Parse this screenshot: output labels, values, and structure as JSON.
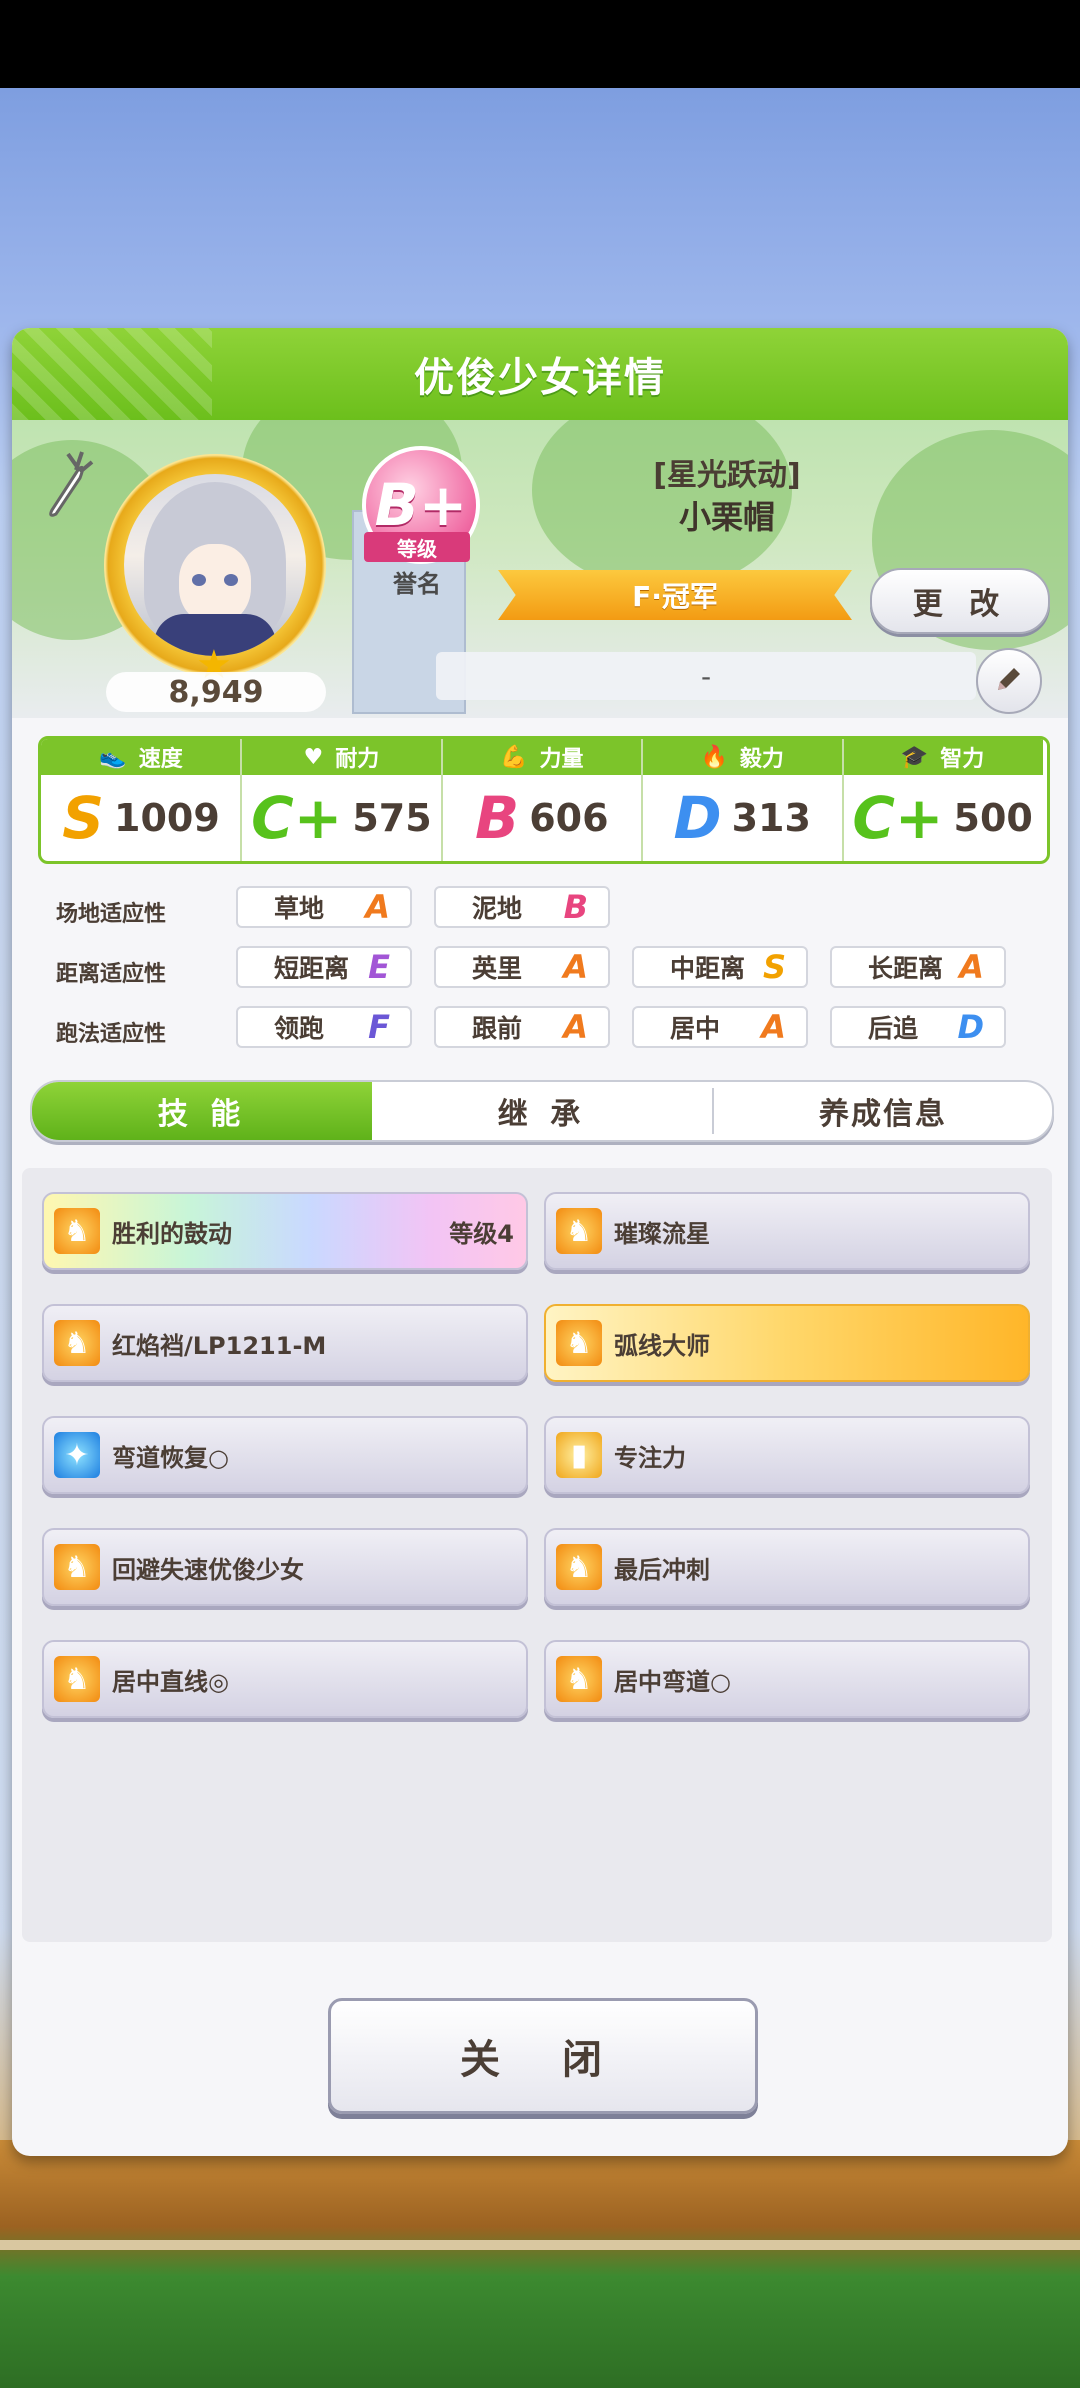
{
  "dialog": {
    "title": "优俊少女详情"
  },
  "profile": {
    "fans": "8,949",
    "rank": "B+",
    "rank_label": "等级",
    "honor_label": "誉名",
    "epithet": "[星光跃动]",
    "name": "小栗帽",
    "title": "F·冠军",
    "change_label": "更 改",
    "comment": "-"
  },
  "stats": [
    {
      "label": "速度",
      "icon": "shoe-icon",
      "grade": "S",
      "value": "1009",
      "color": "#f2a100"
    },
    {
      "label": "耐力",
      "icon": "heart-icon",
      "grade": "C+",
      "value": "575",
      "color": "#57c21c"
    },
    {
      "label": "力量",
      "icon": "arm-icon",
      "grade": "B",
      "value": "606",
      "color": "#e8457f"
    },
    {
      "label": "毅力",
      "icon": "flame-icon",
      "grade": "D",
      "value": "313",
      "color": "#3d8ff0"
    },
    {
      "label": "智力",
      "icon": "graduation-cap-icon",
      "grade": "C+",
      "value": "500",
      "color": "#57c21c"
    }
  ],
  "aptitude": {
    "track": {
      "label": "场地适应性",
      "items": [
        {
          "name": "草地",
          "grade": "A"
        },
        {
          "name": "泥地",
          "grade": "B"
        }
      ]
    },
    "distance": {
      "label": "距离适应性",
      "items": [
        {
          "name": "短距离",
          "grade": "E"
        },
        {
          "name": "英里",
          "grade": "A"
        },
        {
          "name": "中距离",
          "grade": "S"
        },
        {
          "name": "长距离",
          "grade": "A"
        }
      ]
    },
    "style": {
      "label": "跑法适应性",
      "items": [
        {
          "name": "领跑",
          "grade": "F"
        },
        {
          "name": "跟前",
          "grade": "A"
        },
        {
          "name": "居中",
          "grade": "A"
        },
        {
          "name": "后追",
          "grade": "D"
        }
      ]
    }
  },
  "grade_colors": {
    "A": "#f07a1e",
    "B": "#e8457f",
    "D": "#3d8ff0",
    "E": "#a256d6",
    "F": "#6b57d6",
    "S": "#f2a100"
  },
  "tabs": [
    "技 能",
    "继 承",
    "养成信息"
  ],
  "skills": [
    {
      "name": "胜利的鼓动",
      "level": "等级4",
      "icon": "fire-icon",
      "style": "rainbow"
    },
    {
      "name": "璀璨流星",
      "level": "",
      "icon": "fire-icon",
      "style": "normal"
    },
    {
      "name": "红焰裆/LP1211-M",
      "level": "",
      "icon": "fire-icon",
      "style": "normal"
    },
    {
      "name": "弧线大师",
      "level": "",
      "icon": "fire-icon",
      "style": "gold"
    },
    {
      "name": "弯道恢复○",
      "level": "",
      "icon": "sparkle-icon",
      "style": "normal"
    },
    {
      "name": "专注力",
      "level": "",
      "icon": "gate-icon",
      "style": "normal"
    },
    {
      "name": "回避失速优俊少女",
      "level": "",
      "icon": "fire-icon",
      "style": "normal"
    },
    {
      "name": "最后冲刺",
      "level": "",
      "icon": "fire-icon",
      "style": "normal"
    },
    {
      "name": "居中直线◎",
      "level": "",
      "icon": "fire-icon",
      "style": "normal"
    },
    {
      "name": "居中弯道○",
      "level": "",
      "icon": "fire-icon",
      "style": "normal"
    }
  ],
  "close_label": "关 闭"
}
